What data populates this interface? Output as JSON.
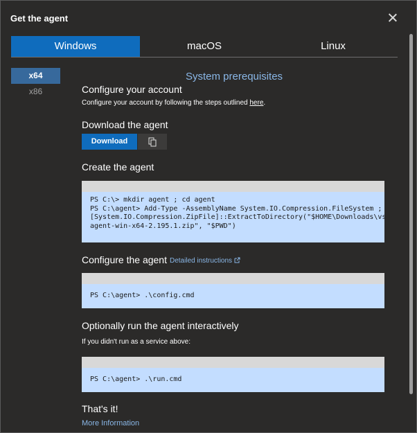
{
  "dialog": {
    "title": "Get the agent"
  },
  "tabs": [
    {
      "label": "Windows"
    },
    {
      "label": "macOS"
    },
    {
      "label": "Linux"
    }
  ],
  "sidebar": {
    "items": [
      {
        "label": "x64"
      },
      {
        "label": "x86"
      }
    ]
  },
  "content": {
    "prereq_link": "System prerequisites",
    "configure_account": {
      "heading": "Configure your account",
      "text": "Configure your account by following the steps outlined",
      "link": "here",
      "suffix": "."
    },
    "download": {
      "heading": "Download the agent",
      "button": "Download"
    },
    "create": {
      "heading": "Create the agent",
      "code": [
        "PS C:\\> mkdir agent ; cd agent",
        "PS C:\\agent> Add-Type -AssemblyName System.IO.Compression.FileSystem ;",
        "[System.IO.Compression.ZipFile]::ExtractToDirectory(\"$HOME\\Downloads\\vsts-",
        "agent-win-x64-2.195.1.zip\", \"$PWD\")"
      ]
    },
    "configure_agent": {
      "heading": "Configure the agent",
      "link": "Detailed instructions",
      "code": [
        "PS C:\\agent> .\\config.cmd"
      ]
    },
    "run": {
      "heading": "Optionally run the agent interactively",
      "text": "If you didn't run as a service above:",
      "code": [
        "PS C:\\agent> .\\run.cmd"
      ]
    },
    "done": {
      "heading": "That's it!",
      "link": "More Information"
    }
  }
}
